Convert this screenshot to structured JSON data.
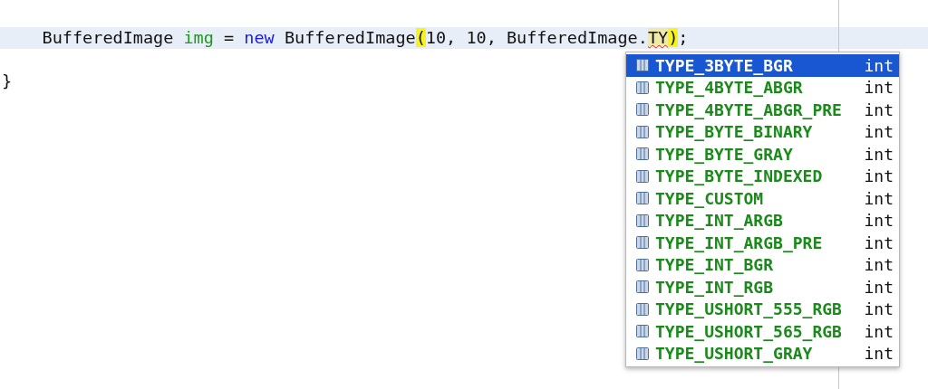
{
  "editor": {
    "lines": [
      {
        "current": false
      },
      {
        "current": true,
        "tokens": [
          {
            "kind": "plain",
            "text": "    BufferedImage "
          },
          {
            "kind": "local",
            "text": "img"
          },
          {
            "kind": "plain",
            "text": " = "
          },
          {
            "kind": "keyword",
            "text": "new"
          },
          {
            "kind": "plain",
            "text": " BufferedImage"
          },
          {
            "kind": "bracket",
            "text": "("
          },
          {
            "kind": "plain",
            "text": "10, 10, BufferedImage."
          },
          {
            "kind": "error",
            "text": "TY"
          },
          {
            "kind": "bracket",
            "text": ")"
          },
          {
            "kind": "plain",
            "text": ";"
          }
        ]
      },
      {
        "current": false
      },
      {
        "current": false,
        "tokens": [
          {
            "kind": "plain",
            "text": "}"
          }
        ]
      }
    ]
  },
  "completion": {
    "items": [
      {
        "name": "TYPE_3BYTE_BGR",
        "type": "int",
        "selected": true
      },
      {
        "name": "TYPE_4BYTE_ABGR",
        "type": "int",
        "selected": false
      },
      {
        "name": "TYPE_4BYTE_ABGR_PRE",
        "type": "int",
        "selected": false
      },
      {
        "name": "TYPE_BYTE_BINARY",
        "type": "int",
        "selected": false
      },
      {
        "name": "TYPE_BYTE_GRAY",
        "type": "int",
        "selected": false
      },
      {
        "name": "TYPE_BYTE_INDEXED",
        "type": "int",
        "selected": false
      },
      {
        "name": "TYPE_CUSTOM",
        "type": "int",
        "selected": false
      },
      {
        "name": "TYPE_INT_ARGB",
        "type": "int",
        "selected": false
      },
      {
        "name": "TYPE_INT_ARGB_PRE",
        "type": "int",
        "selected": false
      },
      {
        "name": "TYPE_INT_BGR",
        "type": "int",
        "selected": false
      },
      {
        "name": "TYPE_INT_RGB",
        "type": "int",
        "selected": false
      },
      {
        "name": "TYPE_USHORT_555_RGB",
        "type": "int",
        "selected": false
      },
      {
        "name": "TYPE_USHORT_565_RGB",
        "type": "int",
        "selected": false
      },
      {
        "name": "TYPE_USHORT_GRAY",
        "type": "int",
        "selected": false
      }
    ]
  }
}
